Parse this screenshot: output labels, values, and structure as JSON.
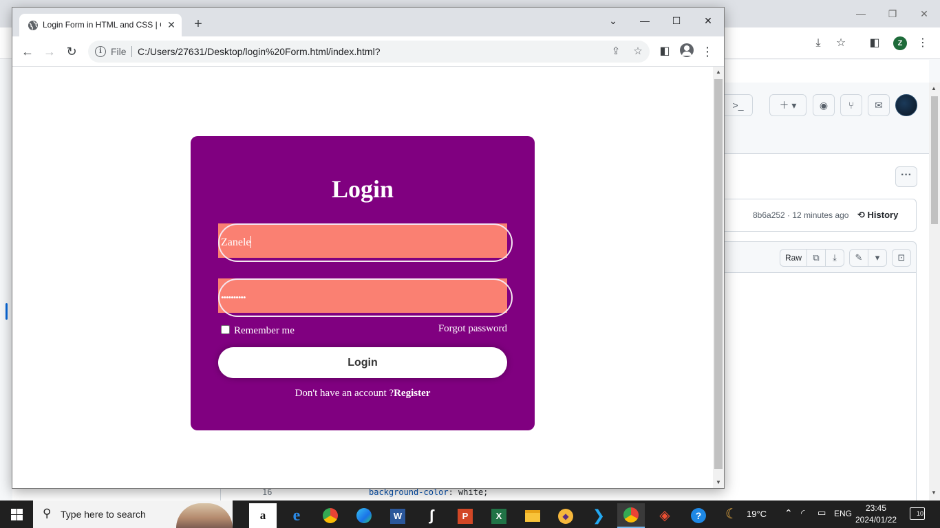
{
  "browser_window": {
    "tab_title": "Login Form in HTML and CSS | C",
    "address_scheme": "File",
    "address_url": "C:/Users/27631/Desktop/login%20Form.html/index.html?"
  },
  "login_form": {
    "title": "Login",
    "username_value": "Zanele",
    "password_value": "••••••••••",
    "remember_label": "Remember me",
    "forgot_label": "Forgot password",
    "login_button": "Login",
    "register_prompt": "Don't have an account ?",
    "register_link": "Register",
    "colors": {
      "card": "#800080",
      "field": "#fa8072",
      "button": "#ffffff"
    }
  },
  "background_window": {
    "profile_initial": "Z",
    "commit_info": "8b6a252 · 12 minutes ago",
    "history_label": "History",
    "raw_label": "Raw",
    "code_line_number": "16",
    "code_property": "background-color",
    "code_value": ": white;"
  },
  "taskbar": {
    "search_placeholder": "Type here to search",
    "temperature": "19°C",
    "language": "ENG",
    "time": "23:45",
    "date": "2024/01/22",
    "notification_count": "10",
    "apps": [
      "amazon-icon",
      "ie-icon",
      "chrome-icon",
      "edge-icon",
      "word-icon",
      "kite-icon",
      "powerpoint-icon",
      "excel-icon",
      "file-explorer-icon",
      "vpn-icon",
      "vscode-icon",
      "chrome-active-icon",
      "git-icon",
      "help-icon"
    ]
  }
}
